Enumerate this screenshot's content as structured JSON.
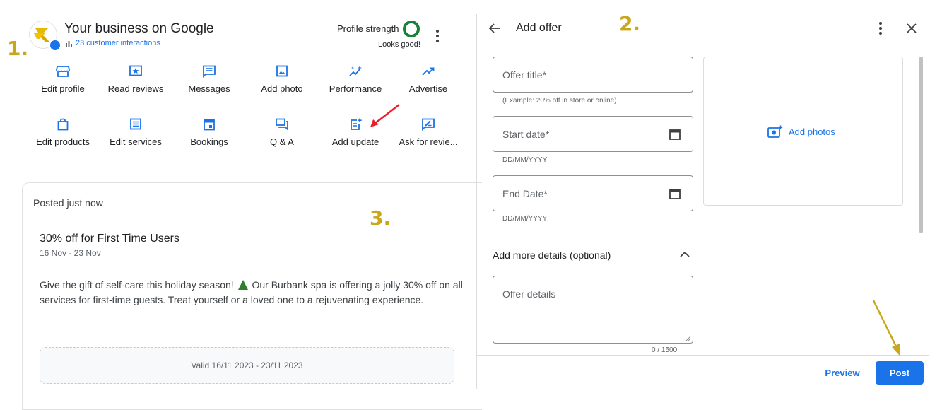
{
  "steps": {
    "one": "1.",
    "two": "2.",
    "three": "3."
  },
  "business": {
    "title": "Your business on Google",
    "interactions": "23 customer interactions",
    "profile_strength_label": "Profile strength",
    "profile_strength_status": "Looks good!"
  },
  "actions_row1": [
    {
      "label": "Edit profile",
      "icon": "store-icon"
    },
    {
      "label": "Read reviews",
      "icon": "star-review-icon"
    },
    {
      "label": "Messages",
      "icon": "message-icon"
    },
    {
      "label": "Add photo",
      "icon": "photo-icon"
    },
    {
      "label": "Performance",
      "icon": "sparkle-chart-icon"
    },
    {
      "label": "Advertise",
      "icon": "trending-up-icon"
    }
  ],
  "actions_row2": [
    {
      "label": "Edit products",
      "icon": "shopping-bag-icon"
    },
    {
      "label": "Edit services",
      "icon": "list-icon"
    },
    {
      "label": "Bookings",
      "icon": "calendar-icon"
    },
    {
      "label": "Q & A",
      "icon": "qa-icon"
    },
    {
      "label": "Add update",
      "icon": "post-add-icon"
    },
    {
      "label": "Ask for revie...",
      "icon": "rate-review-icon"
    }
  ],
  "post": {
    "posted": "Posted just now",
    "title": "30% off for First Time Users",
    "dates": "16 Nov - 23 Nov",
    "body_before": "Give the gift of self-care this holiday season!",
    "body_after": "Our Burbank spa is offering a jolly 30% off on all services for first-time guests. Treat yourself or a loved one to a rejuvenating experience.",
    "valid": "Valid 16/11 2023 - 23/11 2023"
  },
  "panel": {
    "title": "Add offer",
    "offer_title_placeholder": "Offer title*",
    "offer_title_helper": "(Example: 20% off in store or online)",
    "start_date_placeholder": "Start date*",
    "start_date_helper": "DD/MM/YYYY",
    "end_date_placeholder": "End Date*",
    "end_date_helper": "DD/MM/YYYY",
    "add_photos": "Add photos",
    "more_details": "Add more details (optional)",
    "offer_details_placeholder": "Offer details",
    "counter": "0 / 1500",
    "preview": "Preview",
    "post": "Post"
  },
  "colors": {
    "accent_blue": "#1a73e8",
    "annotation_gold": "#c9a61a",
    "annotation_red": "#e8202a",
    "strength_green": "#188038"
  }
}
